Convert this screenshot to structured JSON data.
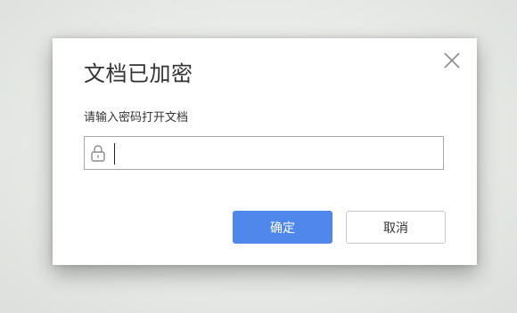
{
  "dialog": {
    "title": "文档已加密",
    "prompt": "请输入密码打开文档",
    "password": {
      "value": "",
      "icon": "lock-icon"
    },
    "close_icon": "close-icon",
    "ok_label": "确定",
    "cancel_label": "取消"
  },
  "colors": {
    "primary_button": "#4f87ea",
    "cancel_border": "#c9c9c9",
    "input_border": "#a9a9a9",
    "title_text": "#333333"
  }
}
